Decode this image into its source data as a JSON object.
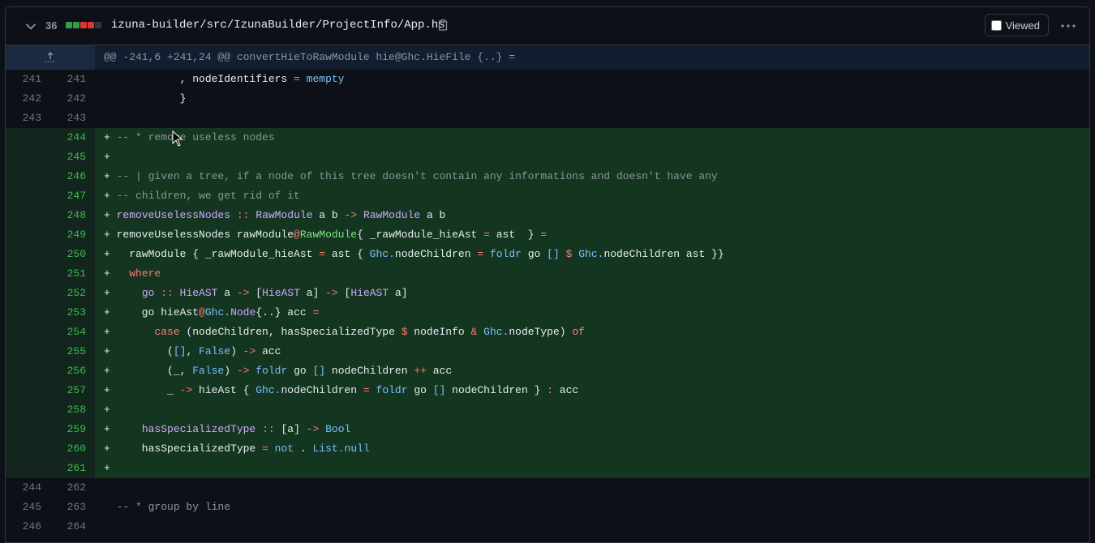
{
  "file": {
    "changed_count": "36",
    "path": "izuna-builder/src/IzunaBuilder/ProjectInfo/App.hs",
    "diffstat": [
      "#2ea043",
      "#2ea043",
      "#da3633",
      "#da3633",
      "#30363d"
    ],
    "viewed_label": "Viewed",
    "viewed_checked": false
  },
  "hunk": {
    "header": "@@ -241,6 +241,24 @@ convertHieToRawModule hie@Ghc.HieFile {..} ="
  },
  "lines": [
    {
      "old": "241",
      "new": "241",
      "type": "ctx",
      "code": "          , nodeIdentifiers = mempty"
    },
    {
      "old": "242",
      "new": "242",
      "type": "ctx",
      "code": "          }"
    },
    {
      "old": "243",
      "new": "243",
      "type": "ctx",
      "code": ""
    },
    {
      "old": "",
      "new": "244",
      "type": "add",
      "code": "-- * remove useless nodes"
    },
    {
      "old": "",
      "new": "245",
      "type": "add",
      "code": ""
    },
    {
      "old": "",
      "new": "246",
      "type": "add",
      "code": "-- | given a tree, if a node of this tree doesn't contain any informations and doesn't have any"
    },
    {
      "old": "",
      "new": "247",
      "type": "add",
      "code": "-- children, we get rid of it"
    },
    {
      "old": "",
      "new": "248",
      "type": "add",
      "code": "removeUselessNodes :: RawModule a b -> RawModule a b"
    },
    {
      "old": "",
      "new": "249",
      "type": "add",
      "code": "removeUselessNodes rawModule@RawModule{ _rawModule_hieAst = ast  } ="
    },
    {
      "old": "",
      "new": "250",
      "type": "add",
      "code": "  rawModule { _rawModule_hieAst = ast { Ghc.nodeChildren = foldr go [] $ Ghc.nodeChildren ast }}"
    },
    {
      "old": "",
      "new": "251",
      "type": "add",
      "code": "  where"
    },
    {
      "old": "",
      "new": "252",
      "type": "add",
      "code": "    go :: HieAST a -> [HieAST a] -> [HieAST a]"
    },
    {
      "old": "",
      "new": "253",
      "type": "add",
      "code": "    go hieAst@Ghc.Node{..} acc ="
    },
    {
      "old": "",
      "new": "254",
      "type": "add",
      "code": "      case (nodeChildren, hasSpecializedType $ nodeInfo & Ghc.nodeType) of"
    },
    {
      "old": "",
      "new": "255",
      "type": "add",
      "code": "        ([], False) -> acc"
    },
    {
      "old": "",
      "new": "256",
      "type": "add",
      "code": "        (_, False) -> foldr go [] nodeChildren ++ acc"
    },
    {
      "old": "",
      "new": "257",
      "type": "add",
      "code": "        _ -> hieAst { Ghc.nodeChildren = foldr go [] nodeChildren } : acc"
    },
    {
      "old": "",
      "new": "258",
      "type": "add",
      "code": ""
    },
    {
      "old": "",
      "new": "259",
      "type": "add",
      "code": "    hasSpecializedType :: [a] -> Bool"
    },
    {
      "old": "",
      "new": "260",
      "type": "add",
      "code": "    hasSpecializedType = not . List.null"
    },
    {
      "old": "",
      "new": "261",
      "type": "add",
      "code": ""
    },
    {
      "old": "244",
      "new": "262",
      "type": "ctx",
      "code": ""
    },
    {
      "old": "245",
      "new": "263",
      "type": "ctx",
      "code": "-- * group by line"
    },
    {
      "old": "246",
      "new": "264",
      "type": "ctx",
      "code": ""
    }
  ]
}
